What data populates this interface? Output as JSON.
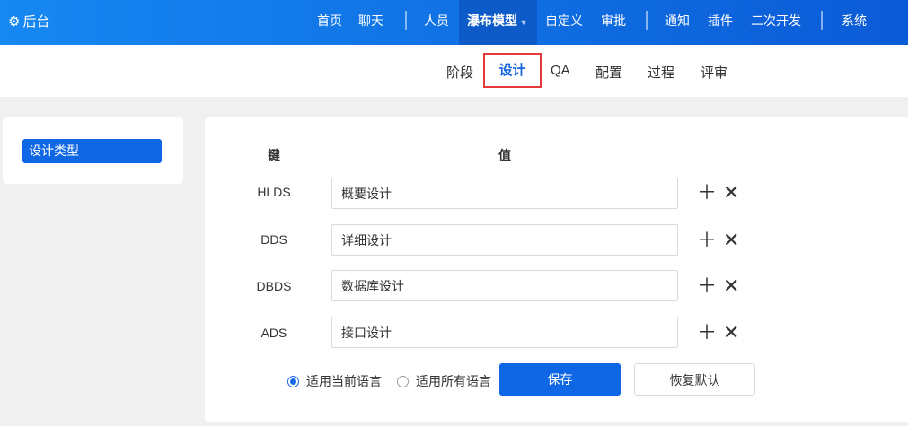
{
  "header": {
    "brand": "后台",
    "items": [
      "首页",
      "聊天",
      "人员",
      "瀑布模型",
      "自定义",
      "审批",
      "通知",
      "插件",
      "二次开发",
      "系统"
    ],
    "active": "瀑布模型"
  },
  "subnav": {
    "items": [
      "阶段",
      "设计",
      "QA",
      "配置",
      "过程",
      "评审"
    ],
    "active": "设计"
  },
  "sidebar": {
    "items": [
      {
        "label": "设计类型"
      }
    ]
  },
  "table": {
    "key_header": "键",
    "value_header": "值",
    "rows": [
      {
        "key": "HLDS",
        "value": "概要设计"
      },
      {
        "key": "DDS",
        "value": "详细设计"
      },
      {
        "key": "DBDS",
        "value": "数据库设计"
      },
      {
        "key": "ADS",
        "value": "接口设计"
      }
    ]
  },
  "footer": {
    "radio_current": "适用当前语言",
    "radio_all": "适用所有语言",
    "selected": "current",
    "save": "保存",
    "reset": "恢复默认"
  },
  "colors": {
    "accent": "#1067e6",
    "highlight": "#e23a3a"
  }
}
